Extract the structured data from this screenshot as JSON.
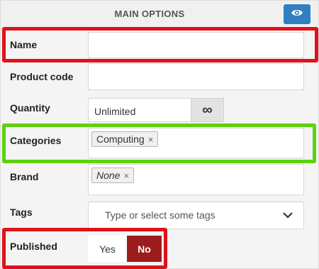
{
  "header": {
    "title": "MAIN OPTIONS",
    "eye_icon": "eye-icon"
  },
  "fields": {
    "name": {
      "label": "Name",
      "value": ""
    },
    "product_code": {
      "label": "Product code",
      "value": ""
    },
    "quantity": {
      "label": "Quantity",
      "value": "Unlimited",
      "infinity_symbol": "∞"
    },
    "categories": {
      "label": "Categories",
      "tags": [
        {
          "text": "Computing",
          "remove": "×"
        }
      ]
    },
    "brand": {
      "label": "Brand",
      "tags": [
        {
          "text": "None",
          "remove": "×"
        }
      ]
    },
    "tags": {
      "label": "Tags",
      "placeholder": "Type or select some tags"
    },
    "published": {
      "label": "Published",
      "options": [
        "Yes",
        "No"
      ],
      "selected": "No"
    }
  },
  "colors": {
    "accent_blue": "#2f7fc1",
    "published_no": "#9c1c1c",
    "highlight_red": "#e0111b",
    "highlight_green": "#5ed10f"
  }
}
